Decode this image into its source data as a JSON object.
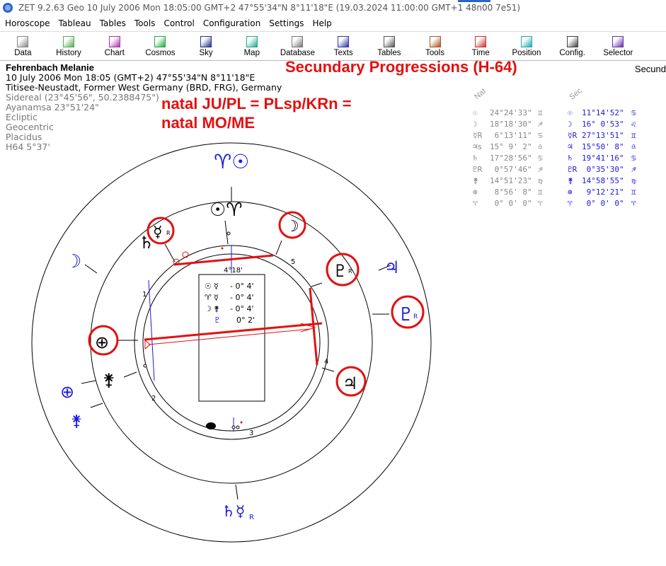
{
  "window": {
    "title": "ZET 9.2.63 Geo   10 July 2006  Mon  18:05:00 GMT+2 47°55'34\"N  8°11'18\"E  (19.03.2024  11:00:00 GMT+1 48n00 7e51)"
  },
  "menu": [
    "Horoscope",
    "Tableau",
    "Tables",
    "Tools",
    "Control",
    "Configuration",
    "Settings",
    "Help"
  ],
  "toolbar": [
    {
      "label": "Data",
      "icon": "data-icon"
    },
    {
      "label": "History",
      "icon": "history-icon"
    },
    {
      "label": "Chart",
      "icon": "chart-icon"
    },
    {
      "label": "Cosmos",
      "icon": "cosmos-icon"
    },
    {
      "label": "Sky",
      "icon": "sky-icon"
    },
    {
      "label": "Map",
      "icon": "map-icon"
    },
    {
      "label": "Database",
      "icon": "database-icon"
    },
    {
      "label": "Texts",
      "icon": "texts-icon"
    },
    {
      "label": "Tables",
      "icon": "tables-icon"
    },
    {
      "label": "Tools",
      "icon": "tools-icon"
    },
    {
      "label": "Time",
      "icon": "time-icon"
    },
    {
      "label": "Position",
      "icon": "position-icon"
    },
    {
      "label": "Config.",
      "icon": "config-icon"
    },
    {
      "label": "Selector",
      "icon": "selector-icon"
    }
  ],
  "info": {
    "name": "Fehrenbach Melanie",
    "date_line": "10 July 2006  Mon  18:05 (GMT+2) 47°55'34\"N  8°11'18\"E",
    "place": "Titisee-Neustadt, Former West Germany (BRD, FRG), Germany",
    "sidereal": "Sidereal (23°45'56\", 50.2388475\")",
    "ayanamsa": "Ayanamsa 23°51'24\"",
    "ecliptic": "Ecliptic",
    "geocentric": "Geocentric",
    "placidus": "Placidus",
    "h64": "H64   5°37'"
  },
  "annotations": {
    "progression_title": "Secundary Progressions (H-64)",
    "right_label": "Secund",
    "formula_line1": "natal JU/PL = PLsp/KRn =",
    "formula_line2": "natal MO/ME"
  },
  "positions": {
    "nat_header": "Nat",
    "sec_header": "Sec",
    "rows": [
      {
        "nat_glyph": "☉",
        "nat": "24°24'33\"",
        "nat_sign": "♊",
        "sec_glyph": "☉",
        "sec": "11°14'52\"",
        "sec_sign": "♋"
      },
      {
        "nat_glyph": "☽",
        "nat": "18°18'30\"",
        "nat_sign": "♐",
        "sec_glyph": "☽",
        "sec": "16° 0'53\"",
        "sec_sign": "♌"
      },
      {
        "nat_glyph": "☿R",
        "nat": " 6°13'11\"",
        "nat_sign": "♋",
        "sec_glyph": "☿R",
        "sec": "27°13'51\"",
        "sec_sign": "♊"
      },
      {
        "nat_glyph": "♃s",
        "nat": "15° 9' 2\"",
        "nat_sign": "♎",
        "sec_glyph": "♃",
        "sec": "15°50' 8\"",
        "sec_sign": "♎"
      },
      {
        "nat_glyph": "♄",
        "nat": "17°28'56\"",
        "nat_sign": "♋",
        "sec_glyph": "♄",
        "sec": "19°41'16\"",
        "sec_sign": "♋"
      },
      {
        "nat_glyph": "♇R",
        "nat": " 0°57'46\"",
        "nat_sign": "♐",
        "sec_glyph": "♇R",
        "sec": " 0°35'30\"",
        "sec_sign": "♐"
      },
      {
        "nat_glyph": "⚵",
        "nat": "14°51'23\"",
        "nat_sign": "♍",
        "sec_glyph": "⚵",
        "sec": "14°58'55\"",
        "sec_sign": "♍"
      },
      {
        "nat_glyph": "⊕",
        "nat": " 8°56' 8\"",
        "nat_sign": "♊",
        "sec_glyph": "⊕",
        "sec": " 9°12'21\"",
        "sec_sign": "♊"
      },
      {
        "nat_glyph": "♈",
        "nat": " 0° 0' 0\"",
        "nat_sign": "♈",
        "sec_glyph": "♈",
        "sec": " 0° 0' 0\"",
        "sec_sign": "♈"
      }
    ]
  },
  "chart_box": {
    "degree": "4°18'",
    "lines": [
      {
        "a": "☉",
        "b": "☿",
        "text": "- 0° 4'"
      },
      {
        "a": "♈",
        "b": "☿",
        "text": "- 0° 4'"
      },
      {
        "a": "☽",
        "b": "⚵",
        "text": "- 0° 4'"
      },
      {
        "a": "",
        "b": "♇",
        "text": "0° 2'"
      }
    ]
  },
  "house_numbers": [
    "1",
    "2",
    "3",
    "4",
    "5"
  ],
  "outer_glyphs": {
    "top": "♈☉",
    "bottom": "♄☿",
    "bottom_r": "R",
    "left_moon": "☽",
    "right_jupiter": "♃",
    "right_pluto": "♇",
    "pluto_r": "R",
    "left_lower1": "⊕",
    "left_lower2": "⚵"
  },
  "inner_glyphs": {
    "top": "☉♈",
    "mercury": "☿",
    "mercury_r": "R",
    "saturn": "♄",
    "moon": "☽",
    "pluto": "♇",
    "pluto_r": "R",
    "earth": "⊕",
    "kronos": "⚵",
    "jupiter": "♃"
  },
  "colors": {
    "accent_red": "#e31010",
    "chart_blue": "#1a1ae6",
    "chart_black": "#000000"
  }
}
